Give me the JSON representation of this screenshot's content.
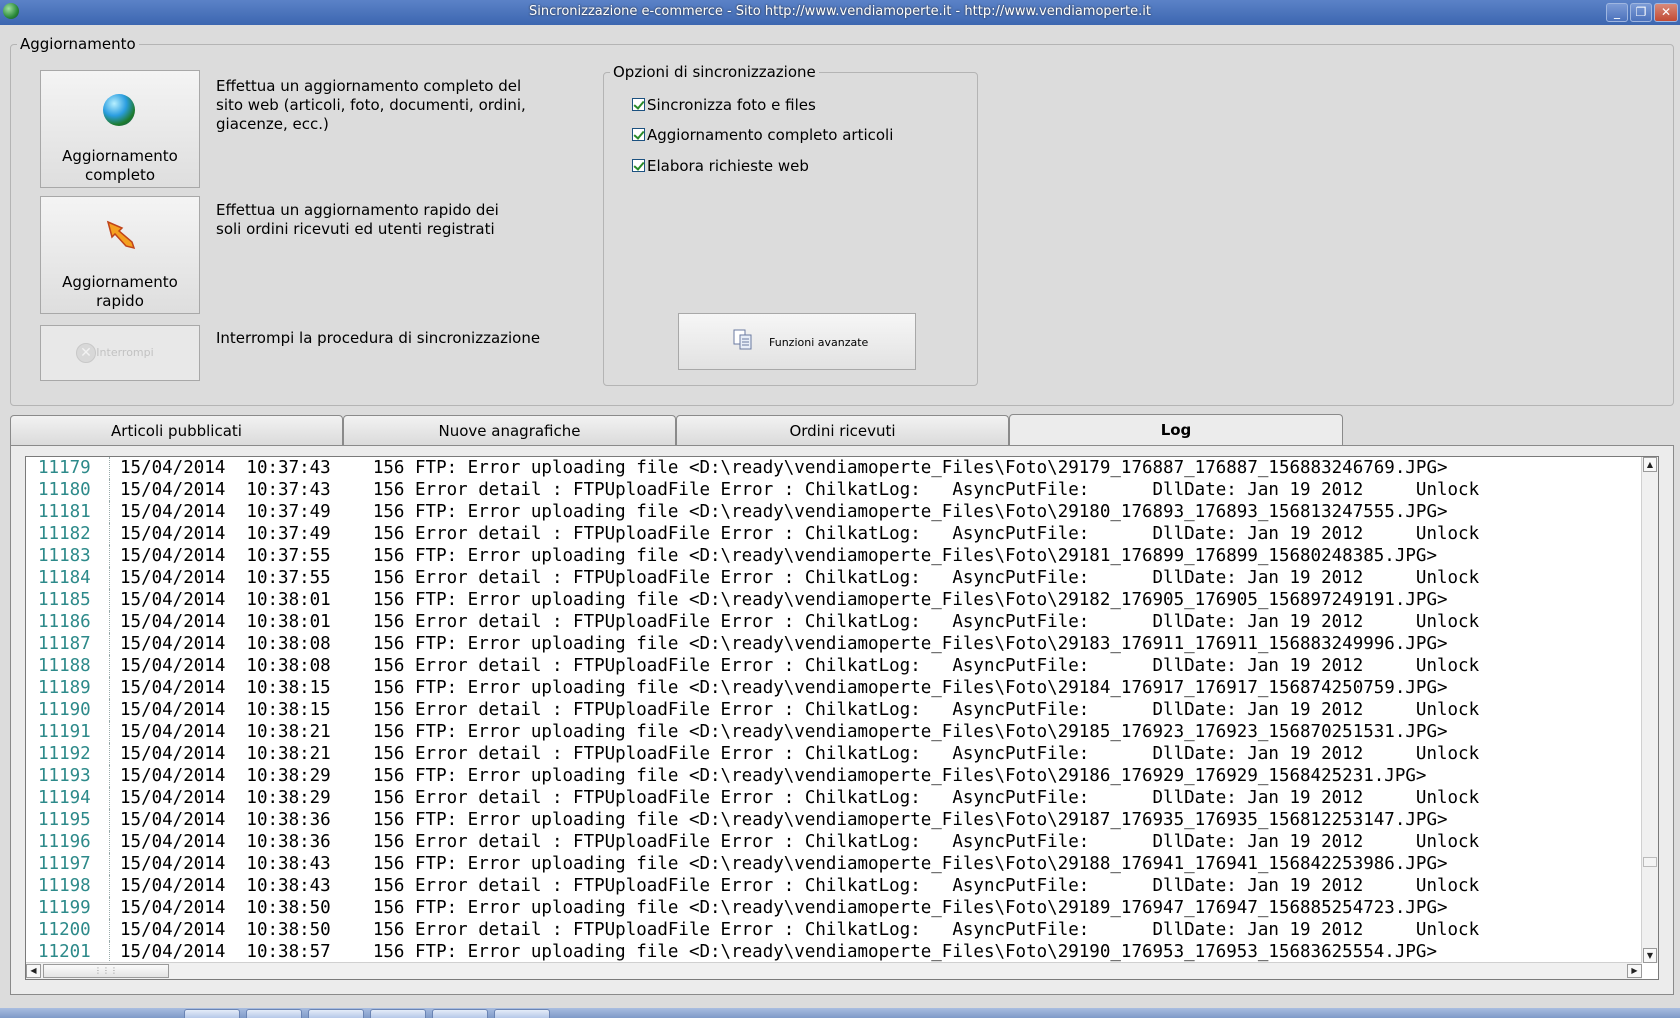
{
  "window": {
    "title": "Sincronizzazione e-commerce - Sito http://www.vendiamoperte.it - http://www.vendiamoperte.it",
    "minimize_glyph": "_",
    "restore_glyph": "❐",
    "close_glyph": "✕"
  },
  "update_group": {
    "legend": "Aggiornamento",
    "full_button_line1": "Aggiornamento",
    "full_button_line2": "completo",
    "full_desc": "Effettua un aggiornamento completo del sito web (articoli, foto, documenti, ordini, giacenze, ecc.)",
    "fast_button_line1": "Aggiornamento",
    "fast_button_line2": "rapido",
    "fast_desc": "Effettua un aggiornamento rapido dei soli ordini ricevuti ed utenti registrati",
    "stop_button_label": "Interrompi",
    "stop_desc": "Interrompi la procedura di sincronizzazione"
  },
  "options_group": {
    "legend": "Opzioni di sincronizzazione",
    "options": [
      {
        "label": "Sincronizza foto e files",
        "checked": true
      },
      {
        "label": "Aggiornamento completo articoli",
        "checked": true
      },
      {
        "label": "Elabora richieste web",
        "checked": true
      }
    ],
    "advanced_button_label": "Funzioni avanzate"
  },
  "tabs": [
    {
      "label": "Articoli pubblicati",
      "active": false
    },
    {
      "label": "Nuove anagrafiche",
      "active": false
    },
    {
      "label": "Ordini ricevuti",
      "active": false
    },
    {
      "label": "Log",
      "active": true
    }
  ],
  "log": {
    "rows": [
      {
        "n": "11179",
        "text": "15/04/2014  10:37:43    156 FTP: Error uploading file <D:\\ready\\vendiamoperte_Files\\Foto\\29179_176887_176887_156883246769.JPG>"
      },
      {
        "n": "11180",
        "text": "15/04/2014  10:37:43    156 Error detail : FTPUploadFile Error : ChilkatLog:   AsyncPutFile:      DllDate: Jan 19 2012     Unlock"
      },
      {
        "n": "11181",
        "text": "15/04/2014  10:37:49    156 FTP: Error uploading file <D:\\ready\\vendiamoperte_Files\\Foto\\29180_176893_176893_156813247555.JPG>"
      },
      {
        "n": "11182",
        "text": "15/04/2014  10:37:49    156 Error detail : FTPUploadFile Error : ChilkatLog:   AsyncPutFile:      DllDate: Jan 19 2012     Unlock"
      },
      {
        "n": "11183",
        "text": "15/04/2014  10:37:55    156 FTP: Error uploading file <D:\\ready\\vendiamoperte_Files\\Foto\\29181_176899_176899_15680248385.JPG>"
      },
      {
        "n": "11184",
        "text": "15/04/2014  10:37:55    156 Error detail : FTPUploadFile Error : ChilkatLog:   AsyncPutFile:      DllDate: Jan 19 2012     Unlock"
      },
      {
        "n": "11185",
        "text": "15/04/2014  10:38:01    156 FTP: Error uploading file <D:\\ready\\vendiamoperte_Files\\Foto\\29182_176905_176905_156897249191.JPG>"
      },
      {
        "n": "11186",
        "text": "15/04/2014  10:38:01    156 Error detail : FTPUploadFile Error : ChilkatLog:   AsyncPutFile:      DllDate: Jan 19 2012     Unlock"
      },
      {
        "n": "11187",
        "text": "15/04/2014  10:38:08    156 FTP: Error uploading file <D:\\ready\\vendiamoperte_Files\\Foto\\29183_176911_176911_156883249996.JPG>"
      },
      {
        "n": "11188",
        "text": "15/04/2014  10:38:08    156 Error detail : FTPUploadFile Error : ChilkatLog:   AsyncPutFile:      DllDate: Jan 19 2012     Unlock"
      },
      {
        "n": "11189",
        "text": "15/04/2014  10:38:15    156 FTP: Error uploading file <D:\\ready\\vendiamoperte_Files\\Foto\\29184_176917_176917_156874250759.JPG>"
      },
      {
        "n": "11190",
        "text": "15/04/2014  10:38:15    156 Error detail : FTPUploadFile Error : ChilkatLog:   AsyncPutFile:      DllDate: Jan 19 2012     Unlock"
      },
      {
        "n": "11191",
        "text": "15/04/2014  10:38:21    156 FTP: Error uploading file <D:\\ready\\vendiamoperte_Files\\Foto\\29185_176923_176923_156870251531.JPG>"
      },
      {
        "n": "11192",
        "text": "15/04/2014  10:38:21    156 Error detail : FTPUploadFile Error : ChilkatLog:   AsyncPutFile:      DllDate: Jan 19 2012     Unlock"
      },
      {
        "n": "11193",
        "text": "15/04/2014  10:38:29    156 FTP: Error uploading file <D:\\ready\\vendiamoperte_Files\\Foto\\29186_176929_176929_1568425231.JPG>"
      },
      {
        "n": "11194",
        "text": "15/04/2014  10:38:29    156 Error detail : FTPUploadFile Error : ChilkatLog:   AsyncPutFile:      DllDate: Jan 19 2012     Unlock"
      },
      {
        "n": "11195",
        "text": "15/04/2014  10:38:36    156 FTP: Error uploading file <D:\\ready\\vendiamoperte_Files\\Foto\\29187_176935_176935_156812253147.JPG>"
      },
      {
        "n": "11196",
        "text": "15/04/2014  10:38:36    156 Error detail : FTPUploadFile Error : ChilkatLog:   AsyncPutFile:      DllDate: Jan 19 2012     Unlock"
      },
      {
        "n": "11197",
        "text": "15/04/2014  10:38:43    156 FTP: Error uploading file <D:\\ready\\vendiamoperte_Files\\Foto\\29188_176941_176941_156842253986.JPG>"
      },
      {
        "n": "11198",
        "text": "15/04/2014  10:38:43    156 Error detail : FTPUploadFile Error : ChilkatLog:   AsyncPutFile:      DllDate: Jan 19 2012     Unlock"
      },
      {
        "n": "11199",
        "text": "15/04/2014  10:38:50    156 FTP: Error uploading file <D:\\ready\\vendiamoperte_Files\\Foto\\29189_176947_176947_156885254723.JPG>"
      },
      {
        "n": "11200",
        "text": "15/04/2014  10:38:50    156 Error detail : FTPUploadFile Error : ChilkatLog:   AsyncPutFile:      DllDate: Jan 19 2012     Unlock"
      },
      {
        "n": "11201",
        "text": "15/04/2014  10:38:57    156 FTP: Error uploading file <D:\\ready\\vendiamoperte_Files\\Foto\\29190_176953_176953_15683625554.JPG>"
      }
    ]
  },
  "colors": {
    "titlebar": "#3c66b0",
    "line_numbers": "#2d8a8a",
    "check": "#2a8a2a"
  }
}
